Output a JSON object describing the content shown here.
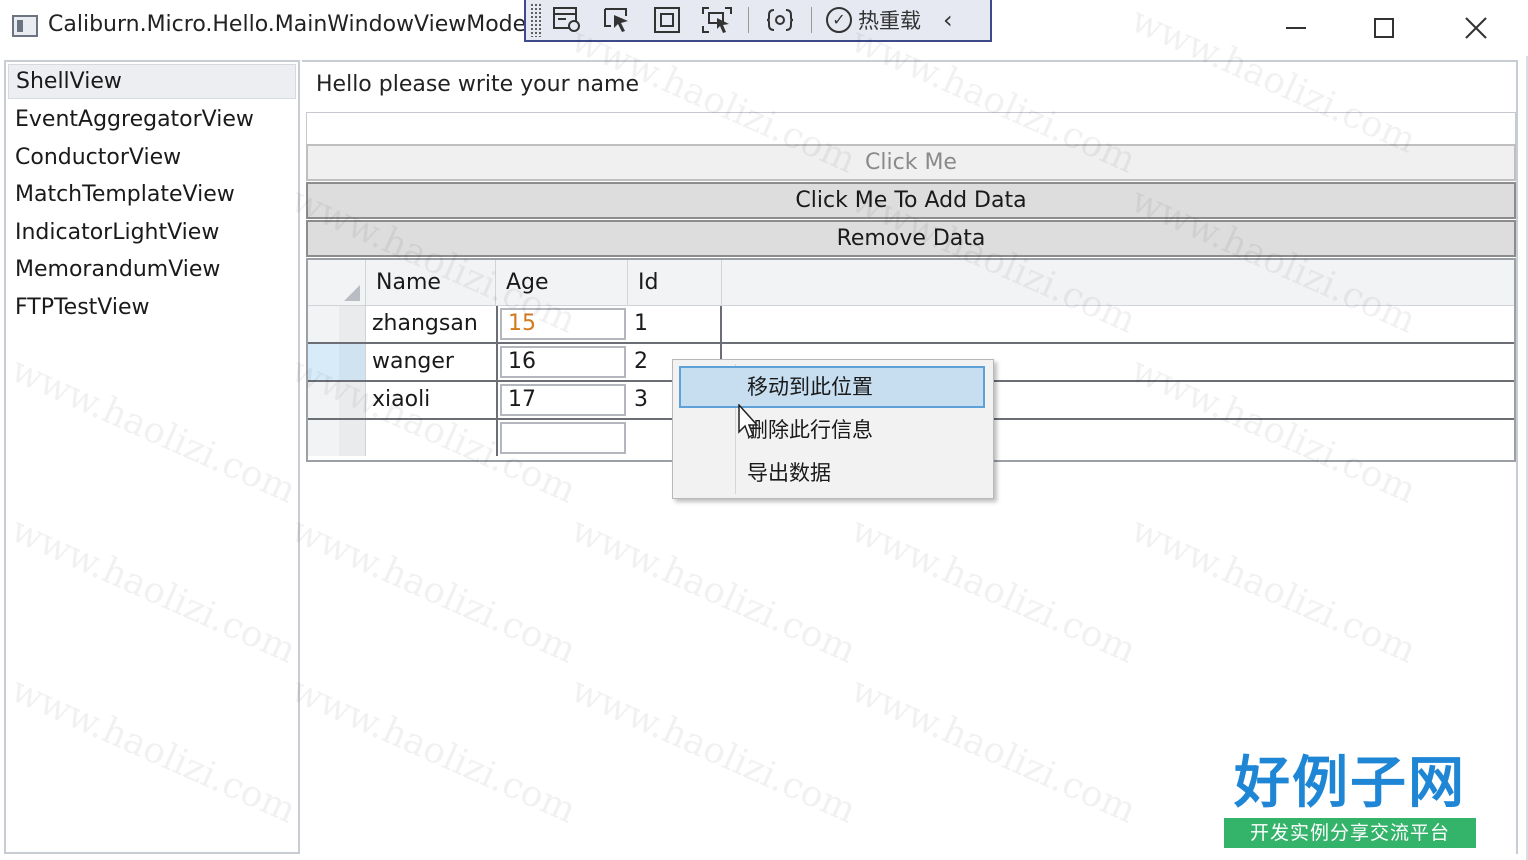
{
  "window": {
    "title": "Caliburn.Micro.Hello.MainWindowViewModel"
  },
  "devbar": {
    "hot_reload_label": "热重载",
    "tools": [
      "live-visual-tree-icon",
      "select-element-icon",
      "display-layout-adorners-icon",
      "track-focus-icon",
      "binding-failures-icon"
    ]
  },
  "sidebar": {
    "items": [
      {
        "label": "ShellView"
      },
      {
        "label": "EventAggregatorView"
      },
      {
        "label": "ConductorView"
      },
      {
        "label": "MatchTemplateView"
      },
      {
        "label": "IndicatorLightView"
      },
      {
        "label": "MemorandumView"
      },
      {
        "label": "FTPTestView"
      }
    ]
  },
  "main": {
    "prompt": "Hello please write your name",
    "name_value": "",
    "buttons": {
      "click_me": "Click Me",
      "add_data": "Click Me To Add Data",
      "remove_data": "Remove Data"
    }
  },
  "grid": {
    "headers": {
      "name": "Name",
      "age": "Age",
      "id": "Id"
    },
    "rows": [
      {
        "name": "zhangsan",
        "age": "15",
        "id": "1"
      },
      {
        "name": "wanger",
        "age": "16",
        "id": "2"
      },
      {
        "name": "xiaoli",
        "age": "17",
        "id": "3"
      },
      {
        "name": "",
        "age": "",
        "id": ""
      }
    ]
  },
  "context_menu": {
    "items": [
      {
        "label": "移动到此位置"
      },
      {
        "label": "删除此行信息"
      },
      {
        "label": "导出数据"
      }
    ]
  },
  "watermark": "www.haolizi.com",
  "brand": {
    "name": "好例子网",
    "tagline": "开发实例分享交流平台"
  },
  "colors": {
    "devbar_border": "#3f4a8a",
    "menu_highlight": "#c6def0",
    "menu_highlight_border": "#5ea1d8",
    "edited_value": "#d47a1e",
    "brand_blue": "#1f86d6",
    "brand_green": "#34b36a"
  }
}
